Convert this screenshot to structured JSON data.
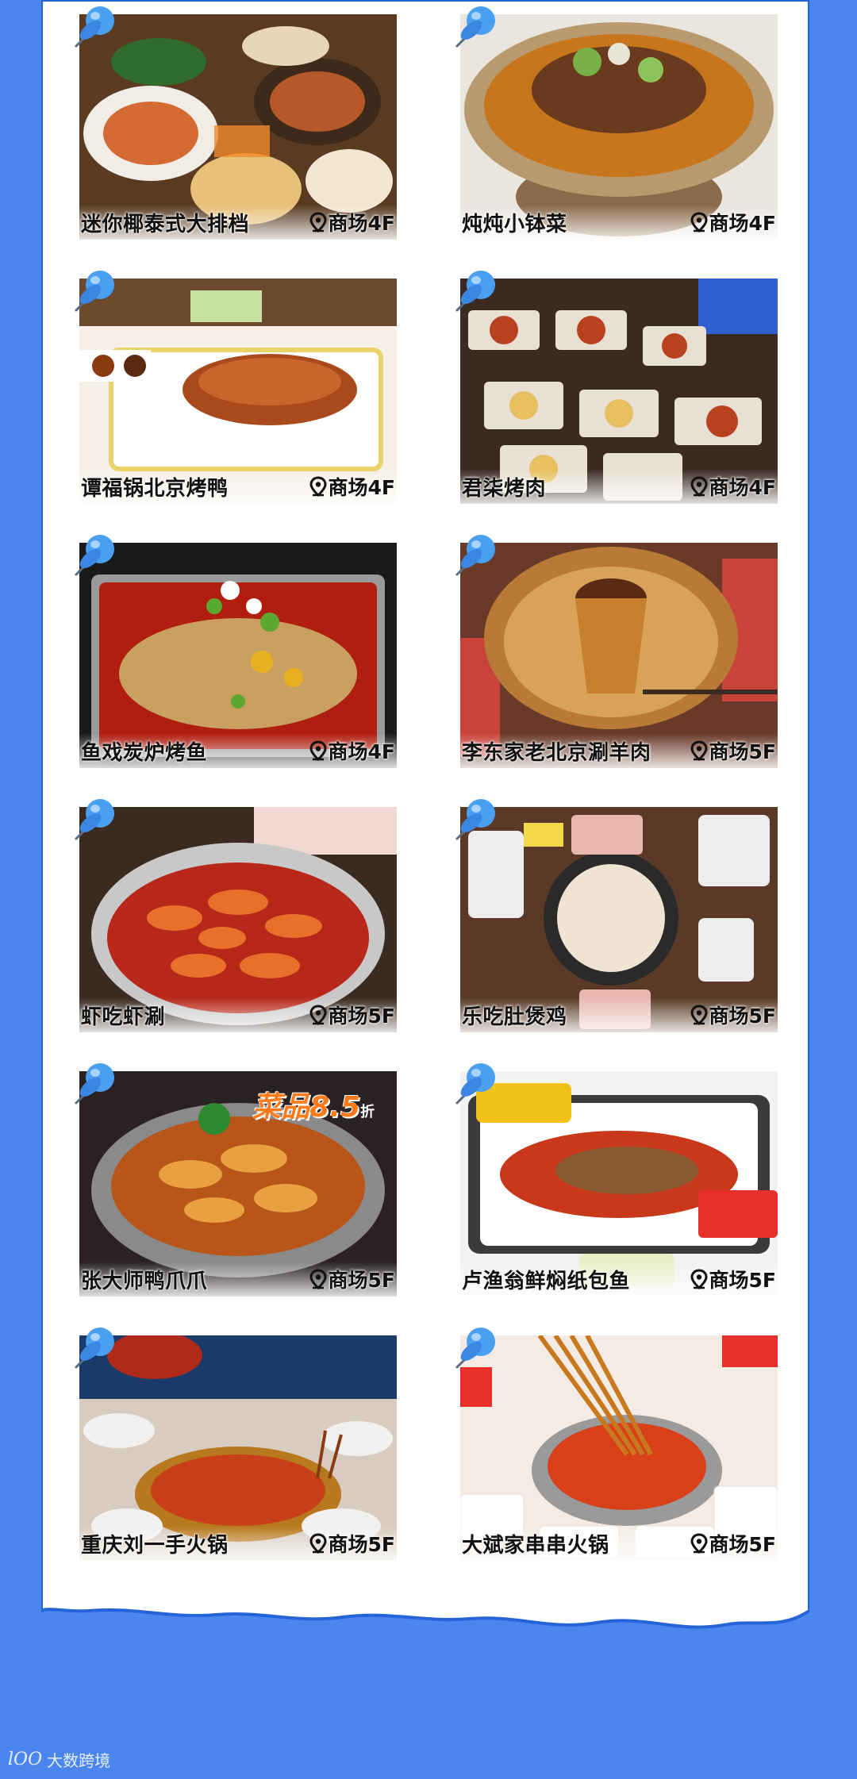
{
  "cards": [
    {
      "name": "迷你椰泰式大排档",
      "location": "商场4F",
      "theme": "thai"
    },
    {
      "name": "炖炖小钵菜",
      "location": "商场4F",
      "theme": "stew"
    },
    {
      "name": "谭福锅北京烤鸭",
      "location": "商场4F",
      "theme": "duck"
    },
    {
      "name": "君柒烤肉",
      "location": "商场4F",
      "theme": "bbq"
    },
    {
      "name": "鱼戏炭炉烤鱼",
      "location": "商场4F",
      "theme": "fish"
    },
    {
      "name": "李东家老北京涮羊肉",
      "location": "商场5F",
      "theme": "hotpot"
    },
    {
      "name": "虾吃虾涮",
      "location": "商场5F",
      "theme": "shrimp"
    },
    {
      "name": "乐吃肚煲鸡",
      "location": "商场5F",
      "theme": "chicken"
    },
    {
      "name": "张大师鸭爪爪",
      "location": "商场5F",
      "theme": "claws",
      "promo": "菜品8.5",
      "promo_suffix": "折"
    },
    {
      "name": "卢渔翁鲜焖纸包鱼",
      "location": "商场5F",
      "theme": "paperfish"
    },
    {
      "name": "重庆刘一手火锅",
      "location": "商场5F",
      "theme": "chongqing"
    },
    {
      "name": "大斌家串串火锅",
      "location": "商场5F",
      "theme": "skewers"
    }
  ],
  "colors": {
    "background": "#4b86ef",
    "paper": "#ffffff",
    "pin": "#4a9ff0",
    "location_icon": "pin-outline-icon"
  },
  "watermark": {
    "logo": "lOO",
    "text": "大数跨境"
  }
}
